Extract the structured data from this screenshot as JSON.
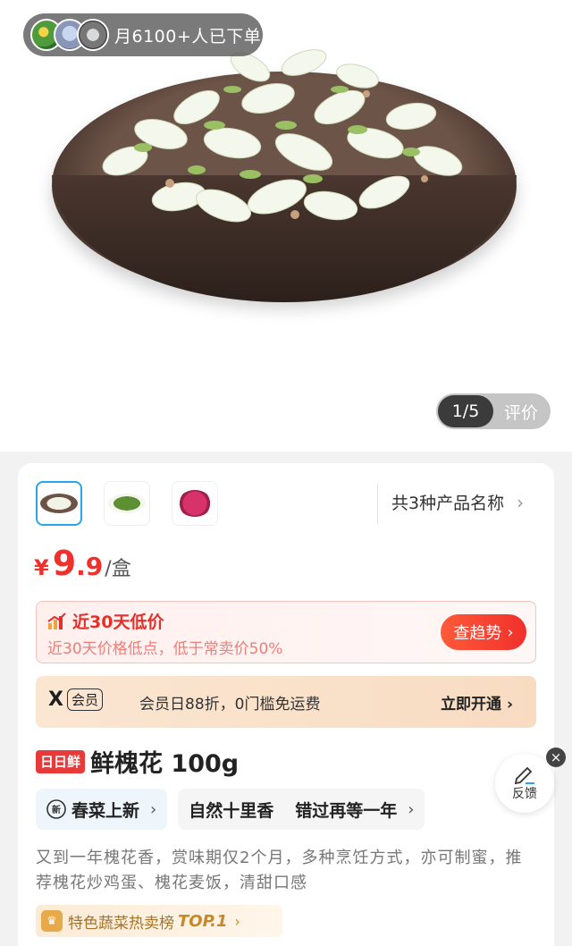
{
  "buyers": {
    "text": "月6100+人已下单"
  },
  "gallery": {
    "position": "1/5",
    "review_label": "评价"
  },
  "variants": {
    "label": "共3种产品名称"
  },
  "price": {
    "currency": "¥",
    "integer": "9",
    "decimal": ".9",
    "unit": "/盒"
  },
  "low_price": {
    "title": "近30天低价",
    "subtitle": "近30天价格低点，低于常卖价50%",
    "button": "查趋势"
  },
  "vip": {
    "logo": "X",
    "tag": "会员",
    "text": "会员日88折，0门槛免运费",
    "button": "立即开通"
  },
  "product": {
    "badge": "日日鲜",
    "title": "鲜槐花 100g"
  },
  "tags": [
    {
      "label": "春菜上新"
    },
    {
      "label": "自然十里香"
    },
    {
      "label": "错过再等一年"
    }
  ],
  "description": "又到一年槐花香，赏味期仅2个月，多种烹饪方式，亦可制蜜，推荐槐花炒鸡蛋、槐花麦饭，清甜口感",
  "ranking": {
    "text": "特色蔬菜热卖榜",
    "top": "TOP.1"
  },
  "feedback": {
    "label": "反馈"
  },
  "colors": {
    "price_red": "#f0302b",
    "accent_blue": "#2aa6e6",
    "gold": "#c5892b"
  }
}
